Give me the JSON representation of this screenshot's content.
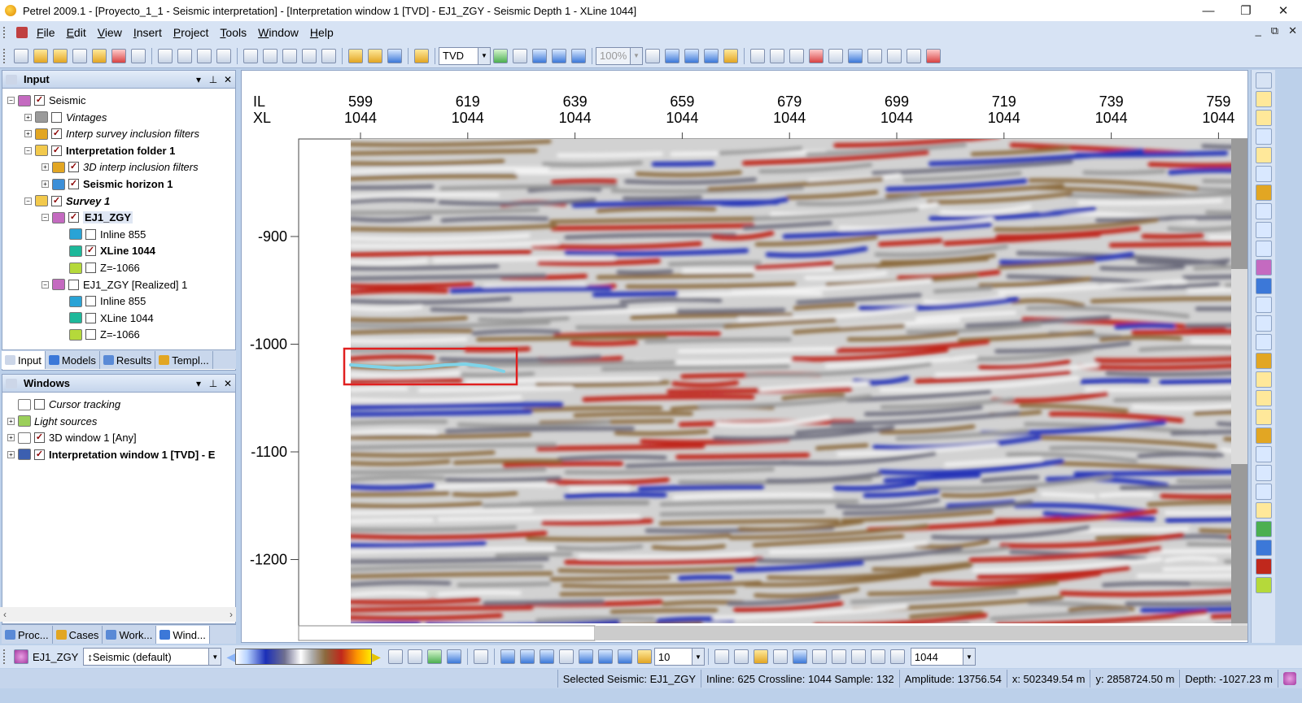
{
  "titlebar": {
    "title": "Petrel 2009.1 - [Proyecto_1_1 - Seismic interpretation] - [Interpretation window 1 [TVD] - EJ1_ZGY - Seismic Depth 1 - XLine 1044]",
    "minimize": "—",
    "restore": "❐",
    "close": "✕"
  },
  "menu": {
    "items": [
      "File",
      "Edit",
      "View",
      "Insert",
      "Project",
      "Tools",
      "Window",
      "Help"
    ],
    "mdi": [
      "_",
      "⧉",
      "✕"
    ]
  },
  "toolbar": {
    "domain_combo": "TVD",
    "zoom_combo": "100%"
  },
  "input_panel": {
    "title": "Input",
    "tree": [
      {
        "label": "Seismic",
        "level": 0,
        "expander": "−",
        "checked": true,
        "style": "normal",
        "icon": "seismic-folder-icon",
        "color": "#c46ac0"
      },
      {
        "label": "Vintages",
        "level": 1,
        "expander": "+",
        "checked": false,
        "style": "italic",
        "icon": "vintages-icon",
        "color": "#9a9a9a"
      },
      {
        "label": "Interp survey inclusion filters",
        "level": 1,
        "expander": "+",
        "checked": true,
        "style": "italic",
        "icon": "filter-icon",
        "color": "#e2a623"
      },
      {
        "label": "Interpretation folder 1",
        "level": 1,
        "expander": "−",
        "checked": true,
        "style": "bold",
        "icon": "folder-icon",
        "color": "#f2c94c"
      },
      {
        "label": "3D interp inclusion filters",
        "level": 2,
        "expander": "+",
        "checked": true,
        "style": "italic",
        "icon": "filter-icon",
        "color": "#e2a623"
      },
      {
        "label": "Seismic horizon 1",
        "level": 2,
        "expander": "+",
        "checked": true,
        "style": "bold",
        "icon": "horizon-icon",
        "color": "#3c8fd8"
      },
      {
        "label": "Survey 1",
        "level": 1,
        "expander": "−",
        "checked": true,
        "style": "bolditalic",
        "icon": "survey-folder-icon",
        "color": "#f2c94c"
      },
      {
        "label": "EJ1_ZGY",
        "level": 2,
        "expander": "−",
        "checked": true,
        "style": "bold",
        "icon": "cube-icon",
        "color": "#c46ac0"
      },
      {
        "label": "Inline 855",
        "level": 3,
        "expander": "",
        "checked": false,
        "style": "normal",
        "icon": "inline-icon",
        "color": "#29a3d6"
      },
      {
        "label": "XLine 1044",
        "level": 3,
        "expander": "",
        "checked": true,
        "style": "bold",
        "icon": "xline-icon",
        "color": "#1db89a"
      },
      {
        "label": "Z=-1066",
        "level": 3,
        "expander": "",
        "checked": false,
        "style": "normal",
        "icon": "zslice-icon",
        "color": "#b5d93a"
      },
      {
        "label": "EJ1_ZGY [Realized] 1",
        "level": 2,
        "expander": "−",
        "checked": false,
        "style": "normal",
        "icon": "cube-icon",
        "color": "#c46ac0"
      },
      {
        "label": "Inline 855",
        "level": 3,
        "expander": "",
        "checked": false,
        "style": "normal",
        "icon": "inline-icon",
        "color": "#29a3d6"
      },
      {
        "label": "XLine 1044",
        "level": 3,
        "expander": "",
        "checked": false,
        "style": "normal",
        "icon": "xline-icon",
        "color": "#1db89a"
      },
      {
        "label": "Z=-1066",
        "level": 3,
        "expander": "",
        "checked": false,
        "style": "normal",
        "icon": "zslice-icon",
        "color": "#b5d93a"
      }
    ],
    "tabs": [
      "Input",
      "Models",
      "Results",
      "Templ..."
    ]
  },
  "windows_panel": {
    "title": "Windows",
    "tree": [
      {
        "label": "Cursor tracking",
        "expander": "",
        "checked": false,
        "style": "italic",
        "icon": "cursor-icon",
        "color": "#ffffff"
      },
      {
        "label": "Light sources",
        "expander": "+",
        "checked": null,
        "style": "italic",
        "icon": "light-icon",
        "color": "#9bcf5a"
      },
      {
        "label": "3D window 1 [Any]",
        "expander": "+",
        "checked": true,
        "style": "normal",
        "icon": "3d-window-icon",
        "color": "#ffffff"
      },
      {
        "label": "Interpretation window 1 [TVD] - E",
        "expander": "+",
        "checked": true,
        "style": "bold",
        "icon": "interp-window-icon",
        "color": "#3c5fb0"
      }
    ],
    "tabs": [
      "Proc...",
      "Cases",
      "Work...",
      "Wind..."
    ]
  },
  "seismic_view": {
    "top_axis": {
      "il_label": "IL",
      "xl_label": "XL",
      "ticks": [
        {
          "il": "599",
          "xl": "1044"
        },
        {
          "il": "619",
          "xl": "1044"
        },
        {
          "il": "639",
          "xl": "1044"
        },
        {
          "il": "659",
          "xl": "1044"
        },
        {
          "il": "679",
          "xl": "1044"
        },
        {
          "il": "699",
          "xl": "1044"
        },
        {
          "il": "719",
          "xl": "1044"
        },
        {
          "il": "739",
          "xl": "1044"
        },
        {
          "il": "759",
          "xl": "1044"
        }
      ]
    },
    "left_axis": {
      "ticks": [
        "-900",
        "-1000",
        "-1100",
        "-1200"
      ]
    },
    "colors": {
      "positive": "#c0281c",
      "negative": "#2535b8",
      "mid": "#f2f2f2",
      "brown": "#8b6a3e",
      "horizon": "#7fd3e8",
      "highlight": "#e02020"
    }
  },
  "bottom_toolbar": {
    "object": "EJ1_ZGY",
    "colortable": "Seismic (default)",
    "step": "10",
    "slice": "1044"
  },
  "statusbar": [
    "Selected Seismic: EJ1_ZGY",
    "Inline: 625 Crossline: 1044 Sample: 132",
    "Amplitude: 13756.54",
    "x: 502349.54 m",
    "y: 2858724.50 m",
    "Depth: -1027.23 m"
  ]
}
